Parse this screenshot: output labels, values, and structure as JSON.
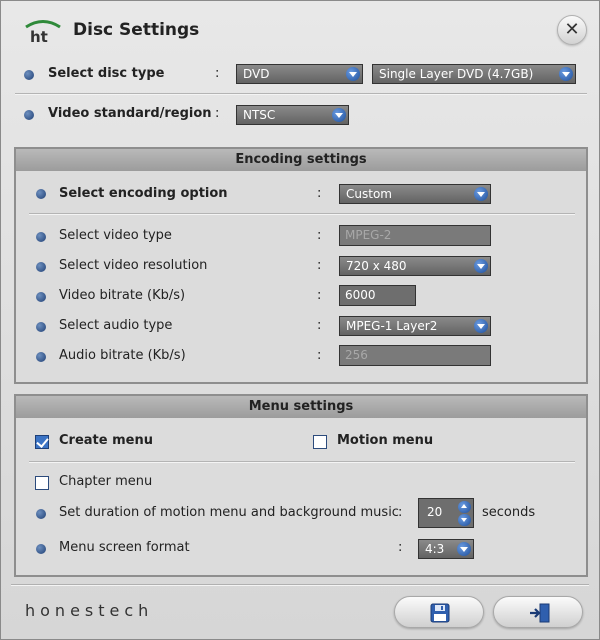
{
  "window": {
    "title": "Disc Settings",
    "close_glyph": "✕"
  },
  "icons": {
    "logo": "ht-logo-icon",
    "close": "close-icon",
    "dropdown": "chevron-down-icon",
    "save": "floppy-disk-icon",
    "exit": "exit-door-icon"
  },
  "colors": {
    "accent": "#3b73c4",
    "field_bg": "#6e6e6e",
    "panel_header": "#a9a9a9"
  },
  "disc": {
    "type_label": "Select disc type",
    "type_value": "DVD",
    "layer_value": "Single Layer DVD (4.7GB)",
    "region_label": "Video standard/region",
    "region_value": "NTSC"
  },
  "encoding": {
    "header": "Encoding settings",
    "option_label": "Select encoding option",
    "option_value": "Custom",
    "video_type_label": "Select video type",
    "video_type_value": "MPEG-2",
    "resolution_label": "Select video resolution",
    "resolution_value": "720 x 480",
    "bitrate_label": "Video bitrate (Kb/s)",
    "bitrate_value": "6000",
    "audio_type_label": "Select audio type",
    "audio_type_value": "MPEG-1 Layer2",
    "audio_bitrate_label": "Audio bitrate (Kb/s)",
    "audio_bitrate_value": "256"
  },
  "menu": {
    "header": "Menu settings",
    "create_label": "Create menu",
    "create_checked": true,
    "motion_label": "Motion menu",
    "motion_checked": false,
    "chapter_label": "Chapter menu",
    "chapter_checked": false,
    "duration_label": "Set duration of motion menu and background music",
    "duration_value": "20",
    "duration_unit": "seconds",
    "format_label": "Menu screen format",
    "format_value": "4:3"
  },
  "colon": ":",
  "footer": {
    "brand": "honestech"
  }
}
